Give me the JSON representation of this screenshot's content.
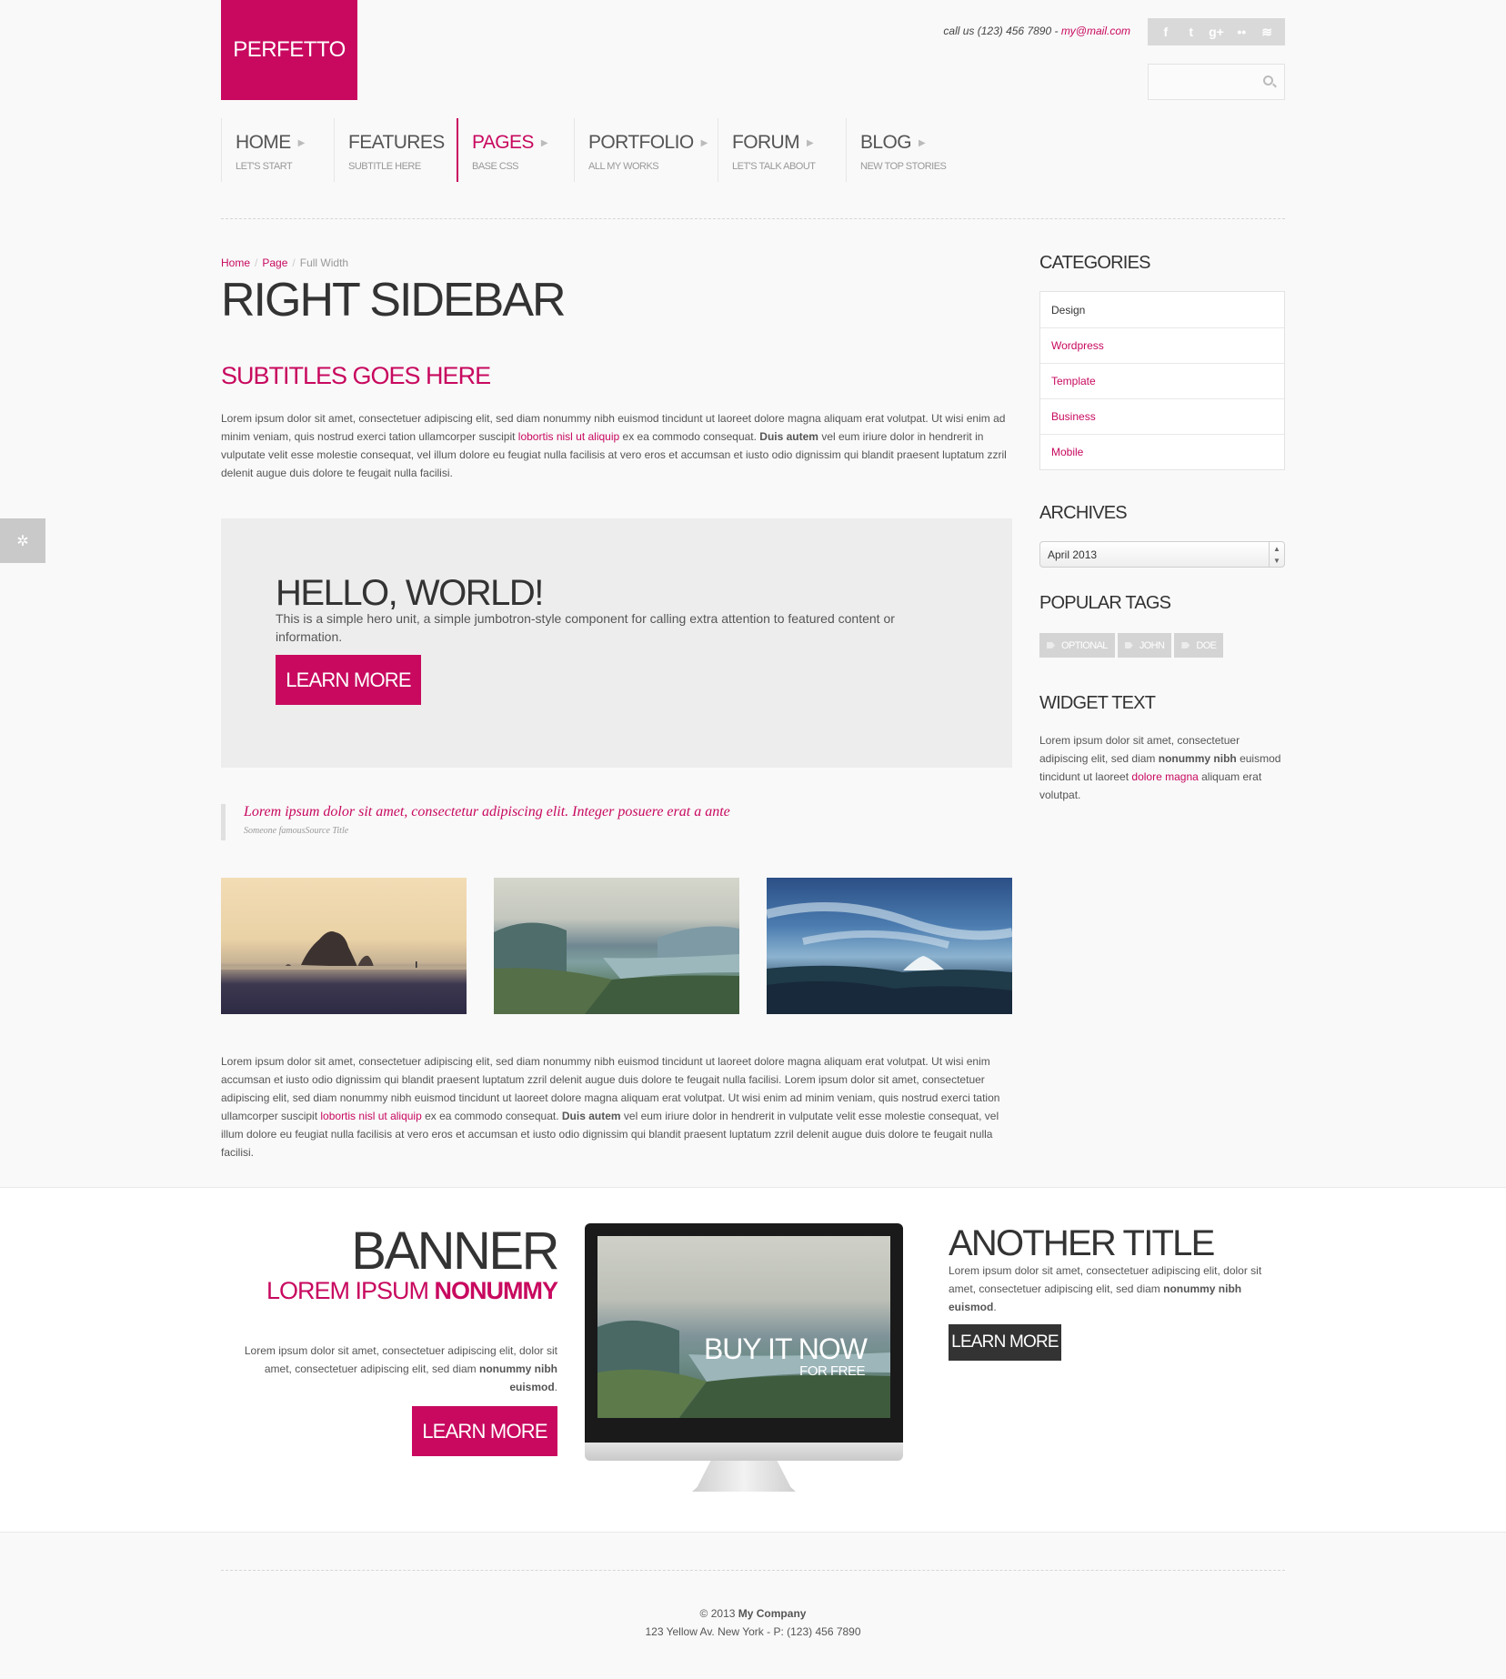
{
  "brand": {
    "logo_text": "PERFETTO",
    "accent": "#c8095f"
  },
  "header": {
    "contact_prefix": "call us (123) 456 7890 - ",
    "contact_email": "my@mail.com",
    "social_icons": [
      "facebook-icon",
      "twitter-icon",
      "google-plus-icon",
      "flickr-icon",
      "rss-icon"
    ],
    "social_glyphs": [
      "f",
      "t",
      "g+",
      "••",
      "≋"
    ],
    "search_placeholder": ""
  },
  "nav": [
    {
      "title": "HOME",
      "subtitle": "LET'S START"
    },
    {
      "title": "FEATURES",
      "subtitle": "SUBTITLE HERE"
    },
    {
      "title": "PAGES",
      "subtitle": "BASE CSS",
      "active": true
    },
    {
      "title": "PORTFOLIO",
      "subtitle": "ALL MY WORKS"
    },
    {
      "title": "FORUM",
      "subtitle": "LET'S TALK ABOUT"
    },
    {
      "title": "BLOG",
      "subtitle": "NEW TOP STORIES"
    }
  ],
  "breadcrumb": {
    "home": "Home",
    "page": "Page",
    "current": "Full Width"
  },
  "main": {
    "title": "RIGHT SIDEBAR",
    "subtitle": "SUBTITLES GOES HERE",
    "intro": {
      "part1": "Lorem ipsum dolor sit amet, consectetuer adipiscing elit, sed diam nonummy nibh euismod tincidunt ut laoreet dolore magna aliquam erat volutpat. Ut wisi enim ad minim veniam, quis nostrud exerci tation ullamcorper suscipit ",
      "link": "lobortis nisl ut aliquip",
      "part2": " ex ea commodo consequat. ",
      "bold": "Duis autem",
      "part3": " vel eum iriure dolor in hendrerit in vulputate velit esse molestie consequat, vel illum dolore eu feugiat nulla facilisis at vero eros et accumsan et iusto odio dignissim qui blandit praesent luptatum zzril delenit augue duis dolore te feugait nulla facilisi."
    },
    "hero": {
      "title": "HELLO, WORLD!",
      "text": "This is a simple hero unit, a simple jumbotron-style component for calling extra attention to featured content or information.",
      "button": "LEARN MORE"
    },
    "quote": {
      "text": "Lorem ipsum dolor sit amet, consectetur adipiscing elit. Integer posuere erat a ante",
      "source": "Someone famousSource Title"
    },
    "body2": {
      "part1": "Lorem ipsum dolor sit amet, consectetuer adipiscing elit, sed diam nonummy nibh euismod tincidunt ut laoreet dolore magna aliquam erat volutpat. Ut wisi enim accumsan et iusto odio dignissim qui blandit praesent luptatum zzril delenit augue duis dolore te feugait nulla facilisi. Lorem ipsum dolor sit amet, consectetuer adipiscing elit, sed diam nonummy nibh euismod tincidunt ut laoreet dolore magna aliquam erat volutpat. Ut wisi enim ad minim veniam, quis nostrud exerci tation ullamcorper suscipit ",
      "link": "lobortis nisl ut aliquip",
      "part2": " ex ea commodo consequat. ",
      "bold": "Duis autem",
      "part3": " vel eum iriure dolor in hendrerit in vulputate velit esse molestie consequat, vel illum dolore eu feugiat nulla facilisis at vero eros et accumsan et iusto odio dignissim qui blandit praesent luptatum zzril delenit augue duis dolore te feugait nulla facilisi."
    }
  },
  "sidebar": {
    "categories_title": "CATEGORIES",
    "categories": [
      "Design",
      "Wordpress",
      "Template",
      "Business",
      "Mobile"
    ],
    "archives_title": "ARCHIVES",
    "archives_selected": "April 2013",
    "tags_title": "POPULAR TAGS",
    "tags": [
      "OPTIONAL",
      "JOHN",
      "DOE"
    ],
    "widget_title": "WIDGET TEXT",
    "widget": {
      "part1": "Lorem ipsum dolor sit amet, consectetuer adipiscing elit, sed diam ",
      "bold": "nonummy nibh",
      "part2": " euismod tincidunt ut laoreet ",
      "link": "dolore magna",
      "part3": " aliquam erat volutpat."
    }
  },
  "banner": {
    "title": "BANNER",
    "sub_plain": "LOREM IPSUM ",
    "sub_bold": "NONUMMY",
    "text_plain": "Lorem ipsum dolor sit amet, consectetuer adipiscing elit, dolor sit amet, consectetuer adipiscing elit, sed diam ",
    "text_bold": "nonummy nibh euismod",
    "text_end": ".",
    "button": "LEARN MORE",
    "screen_title": "BUY IT NOW",
    "screen_sub": "FOR FREE"
  },
  "another": {
    "title": "ANOTHER TITLE",
    "text_plain": "Lorem ipsum dolor sit amet, consectetuer adipiscing elit, dolor sit amet, consectetuer adipiscing elit, sed diam ",
    "text_bold": "nonummy nibh euismod",
    "text_end": ".",
    "button": "LEARN MORE"
  },
  "footer": {
    "copy": "© 2013 ",
    "company": "My Company",
    "address": "123 Yellow Av. New York - P: (123) 456 7890"
  }
}
